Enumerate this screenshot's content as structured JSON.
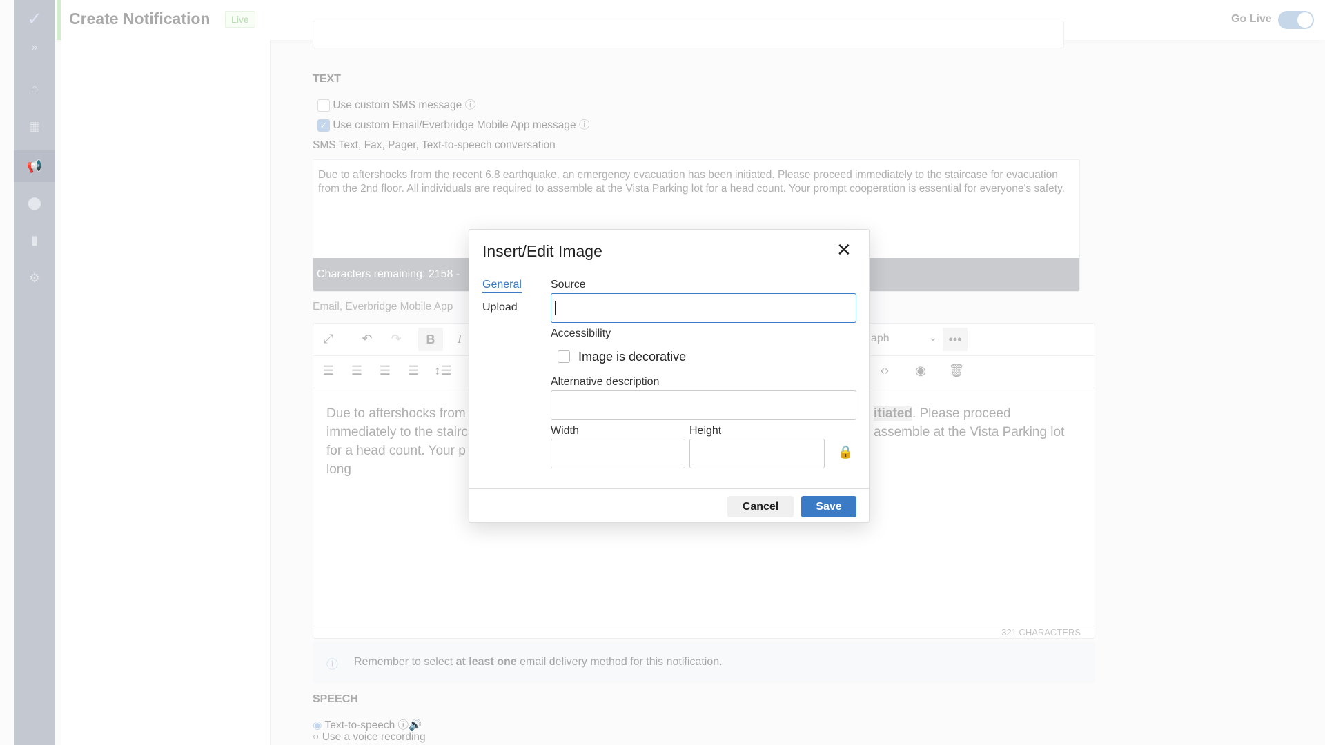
{
  "header": {
    "title": "Create Notification",
    "status_badge": "Live",
    "go_live_label": "Go Live",
    "go_live_on": true
  },
  "sidebar": {
    "items": [
      {
        "icon": "home-icon"
      },
      {
        "icon": "map-icon"
      },
      {
        "icon": "megaphone-icon",
        "active": true
      },
      {
        "icon": "location-pin-icon"
      },
      {
        "icon": "chart-icon"
      },
      {
        "icon": "gear-icon"
      }
    ]
  },
  "text_section": {
    "heading": "TEXT",
    "custom_sms_label": "Use custom SMS message",
    "custom_sms_checked": false,
    "custom_email_label": "Use custom Email/Everbridge Mobile App message",
    "custom_email_checked": true,
    "sms_label": "SMS Text, Fax, Pager, Text-to-speech conversation",
    "sms_text": "Due to aftershocks from the recent 6.8 earthquake, an emergency evacuation has been initiated. Please proceed immediately to the staircase for evacuation from the 2nd floor. All individuals are required to assemble at the Vista Parking lot for a head count. Your prompt cooperation is essential for everyone's safety.",
    "chars_remaining": "Characters remaining: 2158 -",
    "email_label": "Email, Everbridge Mobile App",
    "editor_line1_left": "Due to aftershocks from",
    "editor_line1_bold": "itiated",
    "editor_line1_right": ". Please proceed",
    "editor_line2_left": "immediately to the stairc",
    "editor_line2_right": "assemble at the Vista Parking lot",
    "editor_line3_left": "for a head count. Your p",
    "editor_line4_left": "long",
    "block_format": "aph",
    "char_count": "321 CHARACTERS",
    "info_pre": "Remember to select ",
    "info_bold": "at least one",
    "info_post": " email delivery method for this notification."
  },
  "speech": {
    "heading": "SPEECH",
    "tts_label": "Text-to-speech",
    "tts_selected": true,
    "recording_label": "Use a voice recording"
  },
  "dialog": {
    "title": "Insert/Edit Image",
    "tabs": [
      {
        "label": "General",
        "active": true
      },
      {
        "label": "Upload"
      }
    ],
    "source_label": "Source",
    "source_value": "",
    "accessibility_label": "Accessibility",
    "decorative_label": "Image is decorative",
    "decorative_checked": false,
    "alt_label": "Alternative description",
    "alt_value": "",
    "width_label": "Width",
    "width_value": "",
    "height_label": "Height",
    "height_value": "",
    "cancel": "Cancel",
    "save": "Save"
  },
  "colors": {
    "accent": "#3b7ac4",
    "live_green": "#5cb85c"
  }
}
